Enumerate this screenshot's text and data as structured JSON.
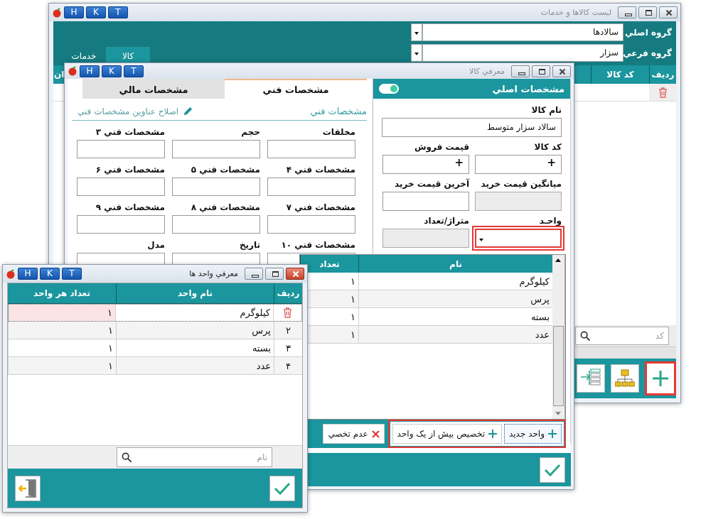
{
  "list_window": {
    "title": "ليست کالاها و خدمات",
    "hotkeys": [
      "T",
      "K",
      "H"
    ],
    "active": false,
    "groups": [
      {
        "label": "گروه اصلي",
        "value": "سالادها"
      },
      {
        "label": "گروه فرعي",
        "value": "سزار"
      }
    ],
    "tabs": [
      {
        "label": "کالا",
        "selected": true
      },
      {
        "label": "خدمات",
        "selected": false
      }
    ],
    "columns": [
      "ردیف",
      "کد کالا",
      "ان"
    ],
    "search": {
      "placeholder": "کد"
    },
    "add_button": {
      "highlighted": true
    }
  },
  "product_window": {
    "title": "معرفي کالا",
    "hotkeys": [
      "T",
      "K",
      "H"
    ],
    "active": false,
    "tabs": [
      {
        "label": "مشخصات فني",
        "selected": true
      },
      {
        "label": "مشخصات مالي",
        "selected": false
      }
    ],
    "tech_title": "مشخصات فني",
    "tech_edit_link": "اصلاح عناوين مشخصات فني",
    "tech_fields": [
      "مخلفات",
      "حجم",
      "مشخصات فني ۳",
      "مشخصات فني ۴",
      "مشخصات فني ۵",
      "مشخصات فني ۶",
      "مشخصات فني ۷",
      "مشخصات فني ۸",
      "مشخصات فني ۹",
      "مشخصات فني ۱۰",
      "تاريخ",
      "مدل"
    ],
    "main_title": "مشخصات اصلي",
    "main_toggle_on": true,
    "name_field": {
      "label": "نام کالا",
      "value": "سالاد سزار متوسط"
    },
    "main_fields": [
      {
        "label": "کد کالا",
        "kind": "plus",
        "value": "+",
        "highlighted": false
      },
      {
        "label": "قيمت فروش",
        "kind": "plus",
        "value": "+",
        "highlighted": false
      },
      {
        "label": "ميانگين قيمت خريد",
        "kind": "disabled",
        "highlighted": false
      },
      {
        "label": "آخرين قيمت خريد",
        "kind": "text",
        "highlighted": false
      },
      {
        "label": "واحـد",
        "kind": "combo",
        "highlighted": true
      },
      {
        "label": "متراژ/تعداد",
        "kind": "disabled",
        "highlighted": false
      }
    ],
    "units_popup": {
      "columns": [
        "نام",
        "تعداد"
      ],
      "rows": [
        {
          "name": "کيلوگرم",
          "count": "۱"
        },
        {
          "name": "پرس",
          "count": "۱"
        },
        {
          "name": "بسته",
          "count": "۱"
        },
        {
          "name": "عدد",
          "count": "۱"
        }
      ],
      "buttons_highlighted": true,
      "buttons": [
        {
          "kind": "add",
          "label": "واحد جديد"
        },
        {
          "kind": "add",
          "label": "تخصيص بيش از يک واحد"
        },
        {
          "kind": "remove",
          "label": "عدم تخصي"
        }
      ]
    }
  },
  "units_window": {
    "title": "معرفي واحد ها",
    "hotkeys": [
      "T",
      "K",
      "H"
    ],
    "active": true,
    "columns": [
      "رديف",
      "نام واحد",
      "تعداد هر واحد"
    ],
    "rows": [
      {
        "selected": true,
        "name": "کيلوگرم",
        "count": "۱"
      },
      {
        "selected": false,
        "index": "۲",
        "name": "پرس",
        "count": "۱"
      },
      {
        "selected": false,
        "index": "۳",
        "name": "بسته",
        "count": "۱"
      },
      {
        "selected": false,
        "index": "۴",
        "name": "عدد",
        "count": "۱"
      }
    ],
    "search": {
      "placeholder": "نام"
    }
  }
}
